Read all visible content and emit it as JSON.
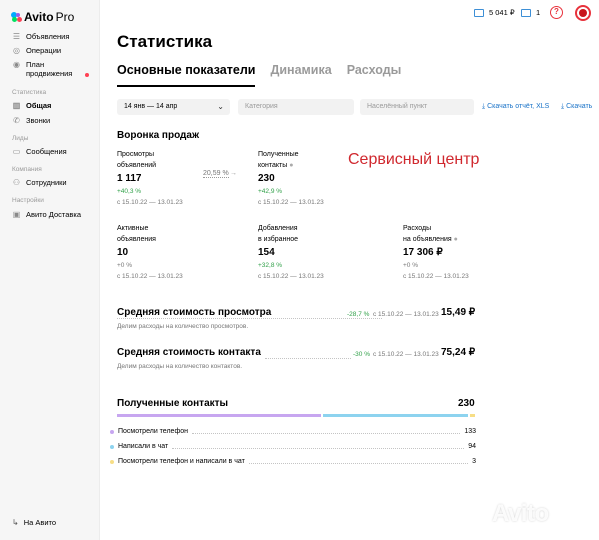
{
  "app": {
    "logo_name": "Avito",
    "logo_suffix": "Pro"
  },
  "sidebar": {
    "items": [
      {
        "label": "Объявления",
        "icon": "list-icon"
      },
      {
        "label": "Операции",
        "icon": "coin-icon"
      },
      {
        "label": "План продвижения",
        "icon": "pin-icon"
      }
    ],
    "section_stats": "Статистика",
    "stats_items": [
      {
        "label": "Общая",
        "icon": "chart-icon",
        "active": true
      },
      {
        "label": "Звонки",
        "icon": "phone-icon"
      }
    ],
    "section_leads": "Лиды",
    "leads_items": [
      {
        "label": "Сообщения",
        "icon": "chat-icon"
      }
    ],
    "section_company": "Компания",
    "company_items": [
      {
        "label": "Сотрудники",
        "icon": "people-icon"
      }
    ],
    "section_settings": "Настройки",
    "settings_items": [
      {
        "label": "Авито Доставка",
        "icon": "box-icon"
      }
    ],
    "footer_link": "На Авито"
  },
  "topbar": {
    "balance": "5 041 ₽",
    "count": "1",
    "help": "?"
  },
  "page": {
    "title": "Статистика",
    "tabs": [
      "Основные показатели",
      "Динамика",
      "Расходы"
    ]
  },
  "filters": {
    "date": "14 янв — 14 апр",
    "category_placeholder": "Категория",
    "city_placeholder": "Населённый пункт",
    "download_xls": "Скачать отчёт, XLS",
    "download_more": "Скачать"
  },
  "funnel": {
    "title": "Воронка продаж",
    "conversion": "20,59 %",
    "overlay_text": "Сервисный центр",
    "metrics": [
      {
        "label_1": "Просмотры",
        "label_2": "объявлений",
        "value": "1 117",
        "change": "+40,3 %",
        "period": "с 15.10.22 — 13.01.23"
      },
      {
        "label_1": "Полученные",
        "label_2": "контакты",
        "value": "230",
        "change": "+42,9 %",
        "period": "с 15.10.22 — 13.01.23"
      },
      {
        "label_1": "Активные",
        "label_2": "объявления",
        "value": "10",
        "change": "+0 %",
        "period": "с 15.10.22 — 13.01.23"
      },
      {
        "label_1": "Добавления",
        "label_2": "в избранное",
        "value": "154",
        "change": "+32,8 %",
        "period": "с 15.10.22 — 13.01.23"
      },
      {
        "label_1": "Расходы",
        "label_2": "на объявления",
        "value": "17 306 ₽",
        "change": "+0 %",
        "period": "с 15.10.22 — 13.01.23"
      }
    ]
  },
  "costs": [
    {
      "title": "Средняя стоимость просмотра",
      "change": "-28,7 %",
      "period": "с 15.10.22 — 13.01.23",
      "value": "15,49 ₽",
      "description": "Делим расходы на количество просмотров."
    },
    {
      "title": "Средняя стоимость контакта",
      "change": "-30 %",
      "period": "с 15.10.22 — 13.01.23",
      "value": "75,24 ₽",
      "description": "Делим расходы на количество контактов."
    }
  ],
  "contacts": {
    "title": "Полученные контакты",
    "total": "230",
    "breakdown": [
      {
        "label": "Посмотрели телефон",
        "value": "133",
        "count": 133,
        "color": "#c7a6f0"
      },
      {
        "label": "Написали в чат",
        "value": "94",
        "count": 94,
        "color": "#8dd3ef"
      },
      {
        "label": "Посмотрели телефон и написали в чат",
        "value": "3",
        "count": 3,
        "color": "#f7de86"
      }
    ]
  },
  "watermark": "Avito"
}
